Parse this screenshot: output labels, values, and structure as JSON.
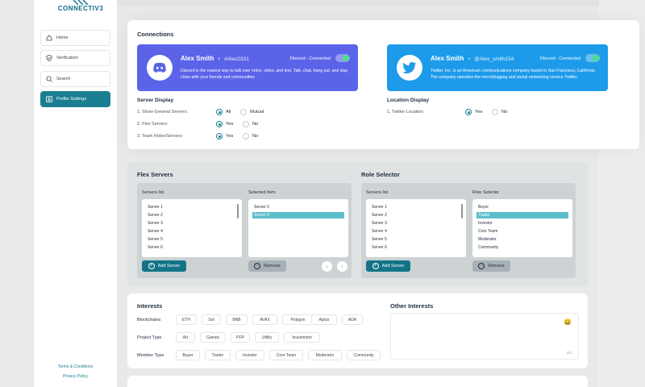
{
  "brand": {
    "name": "CONNECTIV3"
  },
  "sidebar": {
    "items": [
      {
        "label": "Home",
        "icon": "home-icon"
      },
      {
        "label": "Verification",
        "icon": "shield-check-icon"
      },
      {
        "label": "Search",
        "icon": "search-icon"
      },
      {
        "label": "Profile Settings",
        "icon": "profile-card-icon"
      }
    ],
    "footer": {
      "terms": "Terms & Conditions",
      "privacy": "Privacy Policy"
    }
  },
  "connections": {
    "title": "Connections",
    "discord": {
      "name": "Alex Smith",
      "handle": "#Alex2331",
      "status": "Discord - Connected",
      "description": "Discord is the easiest way to talk over voice, video, and text. Talk, chat, hang out, and stay close with your friends and communities",
      "color": "#5b64e8"
    },
    "twitter": {
      "name": "Alex Smith",
      "handle": "@Alex_smith154",
      "status": "Discord - Connected",
      "description": "Twitter, Inc. is an American communications company based in San Francisco, California. The company operates the microblogging and social networking service Twitter.",
      "color": "#1d9bea"
    },
    "server_display": {
      "title": "Server Display",
      "rows": [
        {
          "label": "1. Show General Servers:",
          "options": [
            "All",
            "Mutual"
          ],
          "selected": "All"
        },
        {
          "label": "2. Flex Servers:",
          "options": [
            "Yes",
            "No"
          ],
          "selected": "Yes"
        },
        {
          "label": "3. Team Roles/Servers:",
          "options": [
            "Yes",
            "No"
          ],
          "selected": "Yes"
        }
      ]
    },
    "location_display": {
      "title": "Location Display",
      "rows": [
        {
          "label": "1. Twitter Location:",
          "options": [
            "Yes",
            "No"
          ],
          "selected": "Yes"
        }
      ]
    }
  },
  "flex_servers": {
    "title": "Flex Servers",
    "list_title": "Servers list",
    "selected_title": "Selected Item",
    "servers": [
      "Server 1",
      "Server 2",
      "Server 3",
      "Server 4",
      "Server 5",
      "Server 6"
    ],
    "selected": [
      "Server 5",
      "Server 6"
    ],
    "add_label": "Add Server",
    "remove_label": "Remove"
  },
  "role_selector": {
    "title": "Role Selector",
    "list_title": "Servers list",
    "roles_title": "Role Selector",
    "servers": [
      "Server 1",
      "Server 2",
      "Server 3",
      "Server 4",
      "Server 5",
      "Server 6"
    ],
    "roles": [
      "Buyer",
      "Trader",
      "Investor",
      "Core Team",
      "Moderator",
      "Community"
    ],
    "selected_role": "Trader",
    "add_label": "Add Server",
    "remove_label": "Remove"
  },
  "interests": {
    "title": "Interests",
    "rows": [
      {
        "label": "Blockchains",
        "chips": [
          "ETH",
          "Sol",
          "BNB",
          "AVAX",
          "Polygon",
          "Aptos",
          "ADA"
        ]
      },
      {
        "label": "Project Type",
        "chips": [
          "Art",
          "Games",
          "PFP",
          "Utility",
          "Investment"
        ]
      },
      {
        "label": "Member Type",
        "chips": [
          "Buyer",
          "Trader",
          "Investor",
          "Core Team",
          "Moderator",
          "Community"
        ]
      }
    ],
    "other_title": "Other Interests",
    "counter": "0/2",
    "emoji": "😀"
  }
}
